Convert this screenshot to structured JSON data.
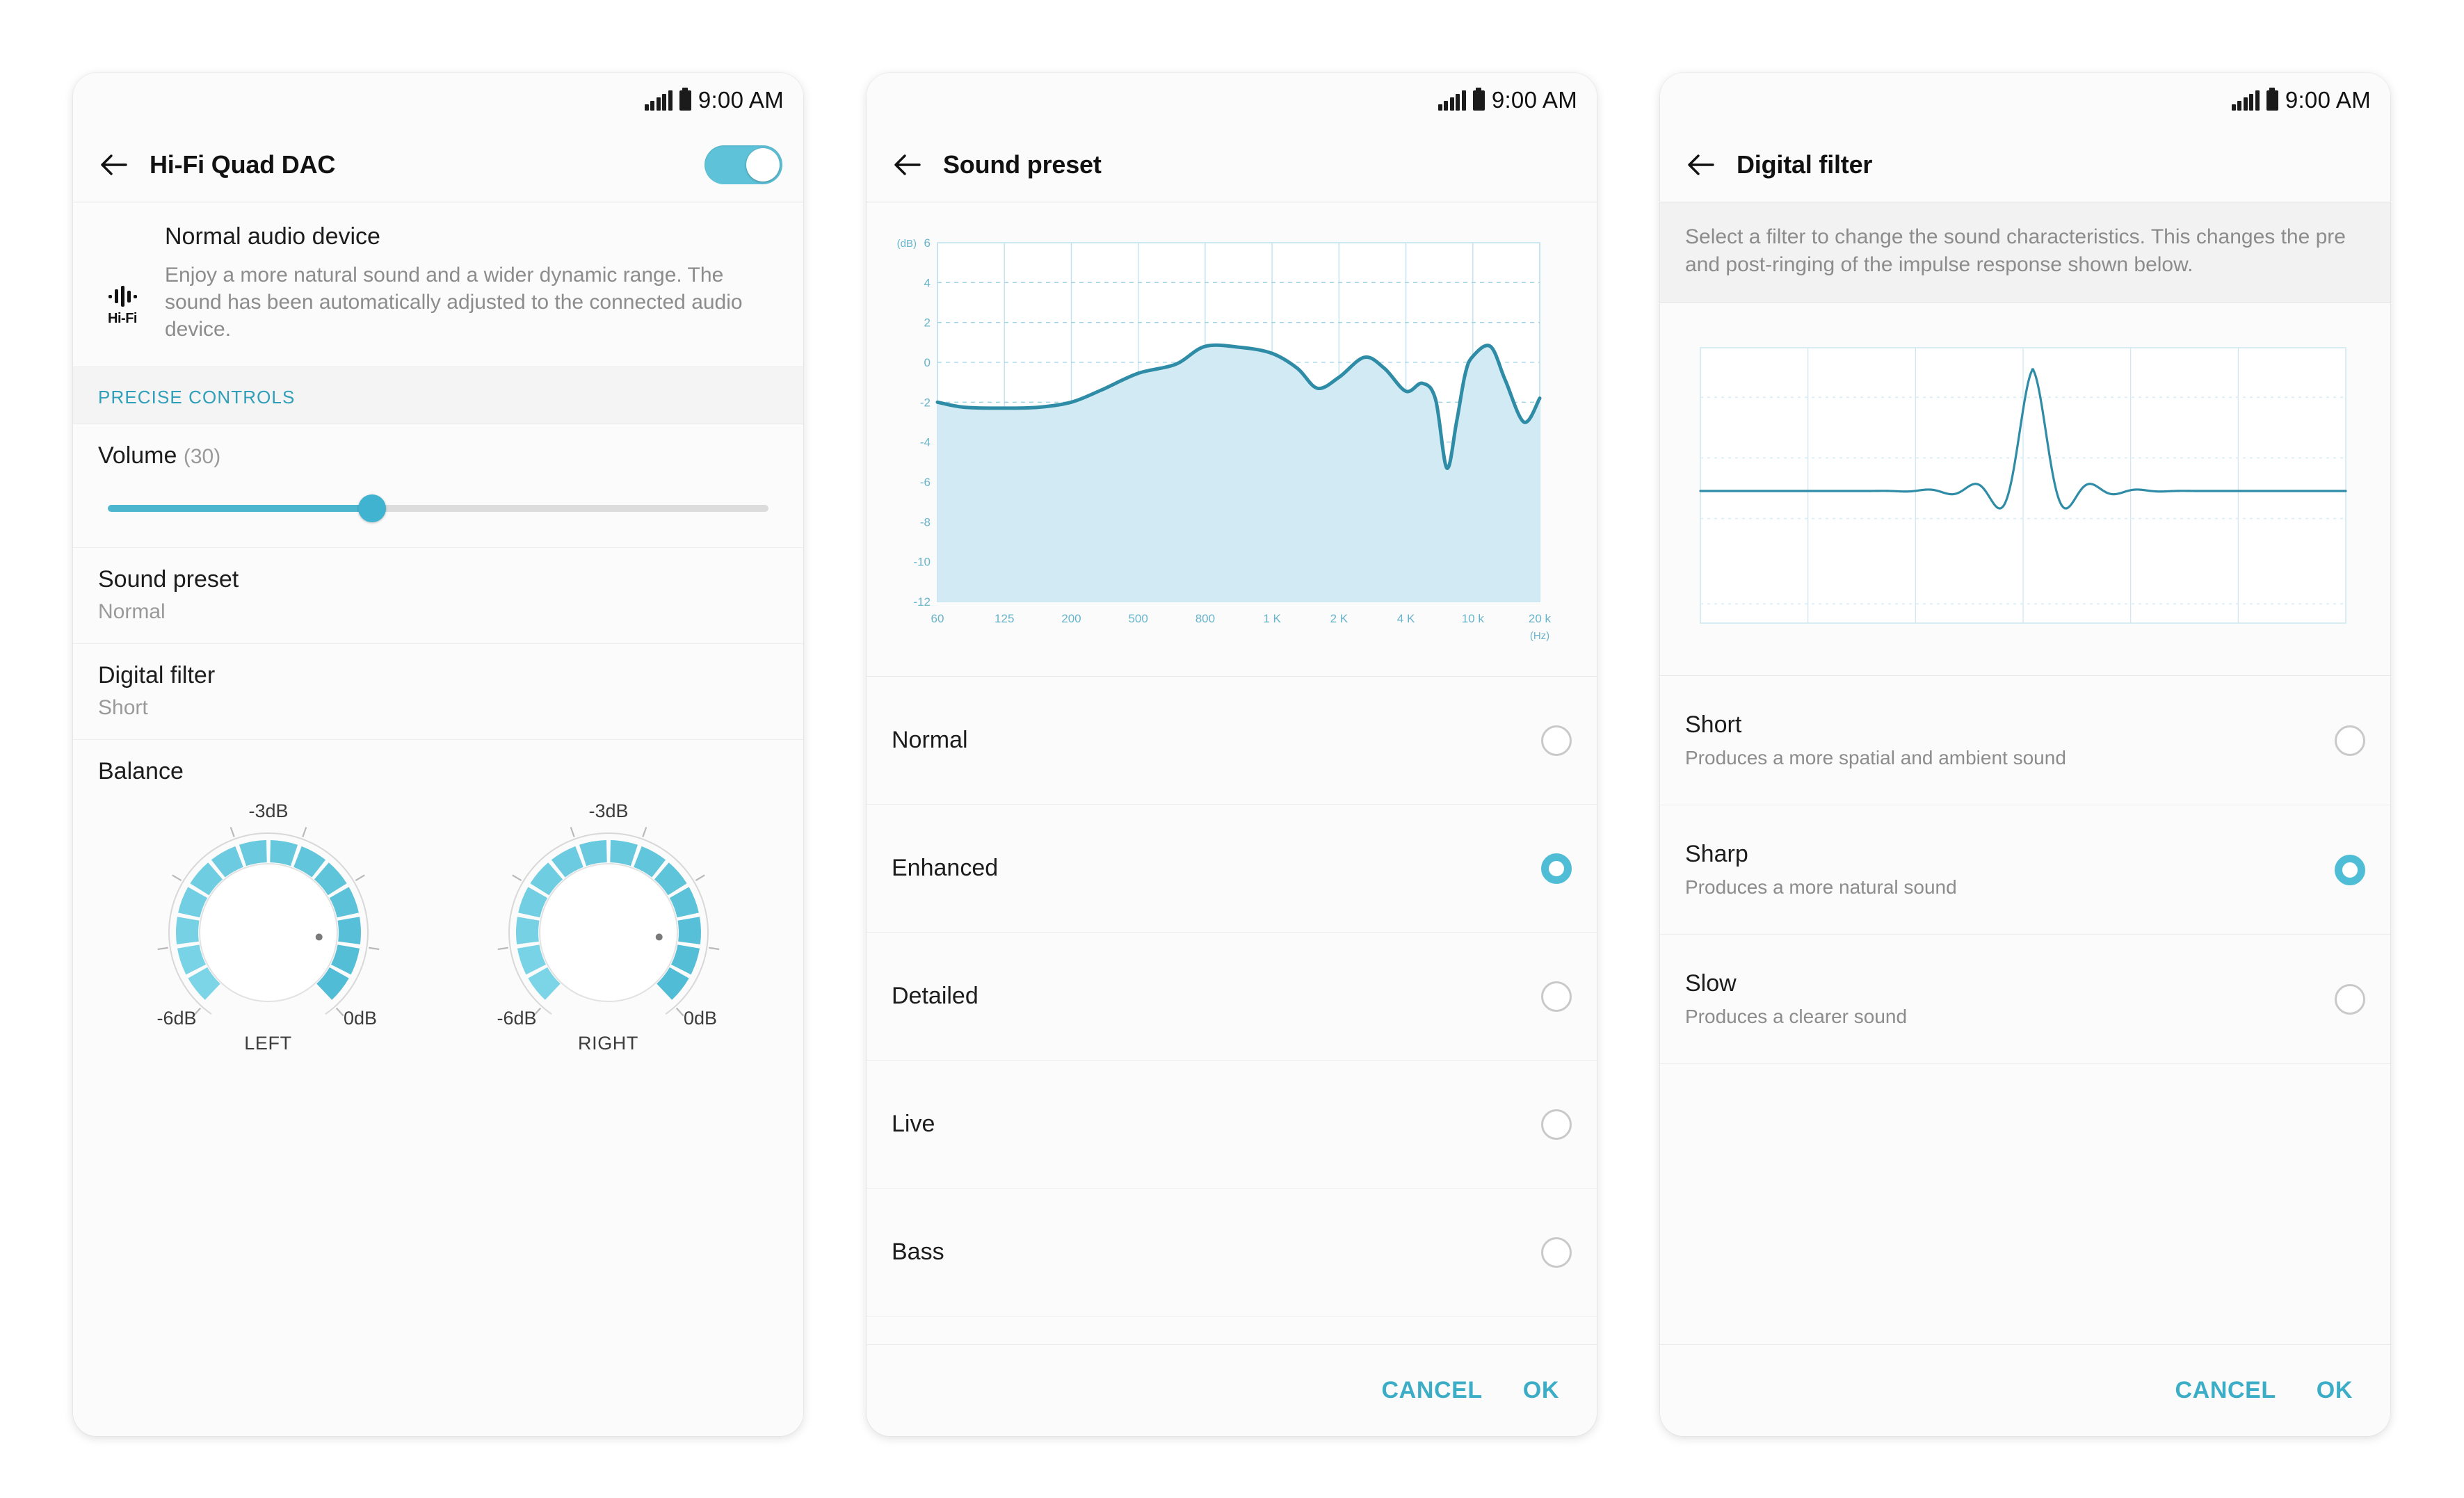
{
  "statusbar": {
    "time": "9:00 AM",
    "signal_icon": "signal-bars-icon",
    "battery_icon": "battery-full-icon"
  },
  "panel1": {
    "title": "Hi-Fi Quad DAC",
    "back_icon": "back-arrow-icon",
    "toggle_state": "on",
    "device": {
      "icon": "hifi-waveform-icon",
      "icon_text": "Hi-Fi",
      "title": "Normal audio device",
      "description": "Enjoy a more natural sound and a wider dynamic range. The sound has been automatically adjusted to the connected audio device."
    },
    "section_header": "PRECISE CONTROLS",
    "volume": {
      "label": "Volume",
      "value_display": "(30)",
      "value": 30,
      "min": 0,
      "max": 75,
      "percent": 40
    },
    "sound_preset": {
      "label": "Sound preset",
      "value": "Normal"
    },
    "digital_filter": {
      "label": "Digital filter",
      "value": "Short"
    },
    "balance": {
      "label": "Balance",
      "left": {
        "caption": "LEFT",
        "top_label": "-3dB",
        "min_label": "-6dB",
        "max_label": "0dB"
      },
      "right": {
        "caption": "RIGHT",
        "top_label": "-3dB",
        "min_label": "-6dB",
        "max_label": "0dB"
      }
    }
  },
  "panel2": {
    "title": "Sound preset",
    "back_icon": "back-arrow-icon",
    "options": [
      {
        "label": "Normal",
        "selected": false
      },
      {
        "label": "Enhanced",
        "selected": true
      },
      {
        "label": "Detailed",
        "selected": false
      },
      {
        "label": "Live",
        "selected": false
      },
      {
        "label": "Bass",
        "selected": false
      }
    ],
    "cancel_label": "CANCEL",
    "ok_label": "OK"
  },
  "panel3": {
    "title": "Digital filter",
    "back_icon": "back-arrow-icon",
    "description": "Select a filter to change the sound characteristics. This changes the pre and post-ringing of the impulse response shown below.",
    "options": [
      {
        "label": "Short",
        "desc": "Produces a more spatial and ambient sound",
        "selected": false
      },
      {
        "label": "Sharp",
        "desc": "Produces a more natural sound",
        "selected": true
      },
      {
        "label": "Slow",
        "desc": "Produces a clearer sound",
        "selected": false
      }
    ],
    "cancel_label": "CANCEL",
    "ok_label": "OK"
  },
  "colors": {
    "accent": "#3badc6",
    "accent_dark": "#2f9fba",
    "toggle_on": "#5ec2d8",
    "radio_on": "#4fbdd6",
    "chart_line": "#2e8ca6",
    "chart_fill": "#d5ecf3",
    "knob_left": "#7ed6e8",
    "knob_right": "#5cc3d9",
    "text_primary": "#1c1c1c",
    "text_secondary": "#8c8c8c"
  },
  "chart_data": [
    {
      "id": "eq-curve",
      "type": "area",
      "title": "",
      "xlabel": "(Hz)",
      "ylabel": "(dB)",
      "xticks": [
        "60",
        "125",
        "200",
        "500",
        "800",
        "1 K",
        "2 K",
        "4 K",
        "10 k",
        "20 k"
      ],
      "yticks": [
        6,
        4,
        2,
        0,
        -2,
        -4,
        -6,
        -8,
        -10,
        -12
      ],
      "ylim": [
        -12,
        6
      ],
      "grid": true,
      "legend": "none",
      "x": [
        60,
        80,
        125,
        160,
        200,
        300,
        500,
        650,
        800,
        900,
        1000,
        1300,
        1600,
        2000,
        2600,
        3200,
        4000,
        5000,
        6000,
        7000,
        8000,
        9000,
        10000,
        12000,
        14000,
        17000,
        20000
      ],
      "values": [
        -2.0,
        -2.25,
        -2.3,
        -2.25,
        -2.0,
        -1.4,
        -0.55,
        -0.1,
        0.8,
        0.75,
        0.45,
        -0.3,
        -1.3,
        -0.75,
        0.25,
        -0.3,
        -1.45,
        -1.05,
        -1.85,
        -5.3,
        -3.0,
        -0.6,
        0.3,
        0.8,
        -0.9,
        -3.0,
        -1.8
      ]
    },
    {
      "id": "impulse-response",
      "type": "line",
      "title": "",
      "xlabel": "",
      "ylabel": "",
      "xticks": [],
      "yticks": [],
      "ylim": [
        -1,
        1
      ],
      "grid": true,
      "legend": "none",
      "description": "Sharp filter impulse response: symmetric sinc with pre- and post-ringing, peak amplitude 1.0 at center",
      "peak": 1.0,
      "ringing": "symmetric"
    }
  ]
}
